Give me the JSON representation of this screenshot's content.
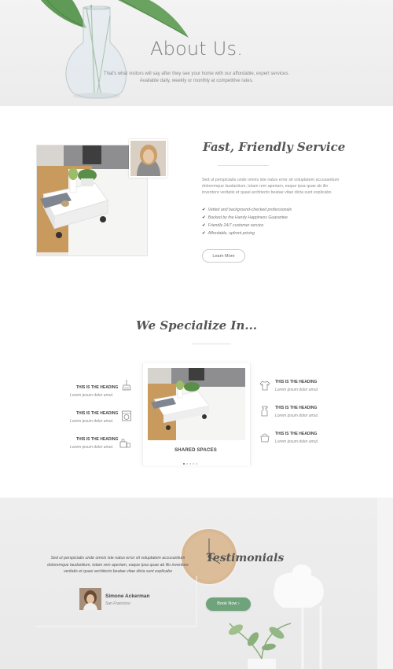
{
  "hero": {
    "title": "About Us.",
    "subtitle_line1": "That's what visitors will say after they see your home with our affordable, expert services.",
    "subtitle_line2": "Available daily, weekly or monthly at competitive rates."
  },
  "service": {
    "title": "Fast, Friendly Service",
    "body": "Sed ut perspiciatis unde omnis iste natus error sit voluptatem accusantium doloremque laudantium, totam rem aperiam, eaque ipsa quae ab illo inventore veritatis et quasi architecto beatae vitae dicta sunt explicabo.",
    "checklist": [
      "Vetted and background-checked professionals",
      "Backed by the Handy Happiness Guarantee",
      "Friendly 24/7 customer service",
      "Affordable, upfront pricing"
    ],
    "button_label": "Learn More"
  },
  "specialize": {
    "title": "We Specialize In...",
    "left_features": [
      {
        "heading": "THIS IS THE HEADING",
        "text": "Lorem ipsum dolor amut.",
        "icon": "broom-icon"
      },
      {
        "heading": "THIS IS THE HEADING",
        "text": "Lorem ipsum dolor amut.",
        "icon": "washing-machine-icon"
      },
      {
        "heading": "THIS IS THE HEADING",
        "text": "Lorem ipsum dolor amut.",
        "icon": "cleaning-supplies-icon"
      }
    ],
    "right_features": [
      {
        "heading": "THIS IS THE HEADING",
        "text": "Lorem ipsum dolor amut.",
        "icon": "shirt-icon"
      },
      {
        "heading": "THIS IS THE HEADING",
        "text": "Lorem ipsum dolor amut.",
        "icon": "spray-bottle-icon"
      },
      {
        "heading": "THIS IS THE HEADING",
        "text": "Lorem ipsum dolor amut.",
        "icon": "bucket-icon"
      }
    ],
    "slider_label": "SHARED SPACES"
  },
  "testimonials": {
    "title": "Testimonials",
    "quote": "Sed ut perspiciatis unde omnis iste natus error sit voluptatem accusantium doloremque laudantium, totam rem aperiam, eaque ipsa quae ab illo inventore veritatis et quasi architecto beatae vitae dicta sunt explicabo",
    "name": "Simone Ackerman",
    "location": "San Francisco",
    "button_label": "Book Now ›"
  },
  "colors": {
    "accent_green": "#6fa37b",
    "text_dark": "#444444",
    "text_muted": "#888888",
    "section_gray": "#ececec"
  }
}
